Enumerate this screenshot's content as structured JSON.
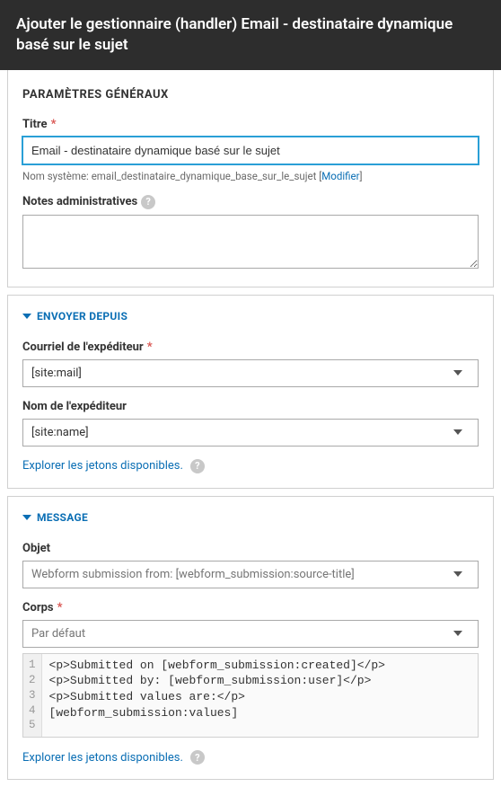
{
  "header": {
    "title": "Ajouter le gestionnaire (handler) Email - destinataire dynamique basé sur le sujet"
  },
  "general": {
    "section_title": "Paramètres généraux",
    "title_label": "Titre",
    "title_value": "Email - destinataire dynamique basé sur le sujet",
    "system_name_prefix": "Nom système: ",
    "system_name_value": "email_destinataire_dynamique_base_sur_le_sujet",
    "system_name_edit": "Modifier",
    "notes_label": "Notes administratives"
  },
  "send_from": {
    "section_title": "Envoyer depuis",
    "from_email_label": "Courriel de l'expéditeur",
    "from_email_value": "[site:mail]",
    "from_name_label": "Nom de l'expéditeur",
    "from_name_value": "[site:name]",
    "explore_tokens": "Explorer les jetons disponibles."
  },
  "message": {
    "section_title": "Message",
    "subject_label": "Objet",
    "subject_value": "Webform submission from: [webform_submission:source-title]",
    "body_label": "Corps",
    "body_select": "Par défaut",
    "body_lines": [
      "<p>Submitted on [webform_submission:created]</p>",
      "<p>Submitted by: [webform_submission:user]</p>",
      "<p>Submitted values are:</p>",
      "[webform_submission:values]",
      ""
    ],
    "explore_tokens": "Explorer les jetons disponibles."
  }
}
